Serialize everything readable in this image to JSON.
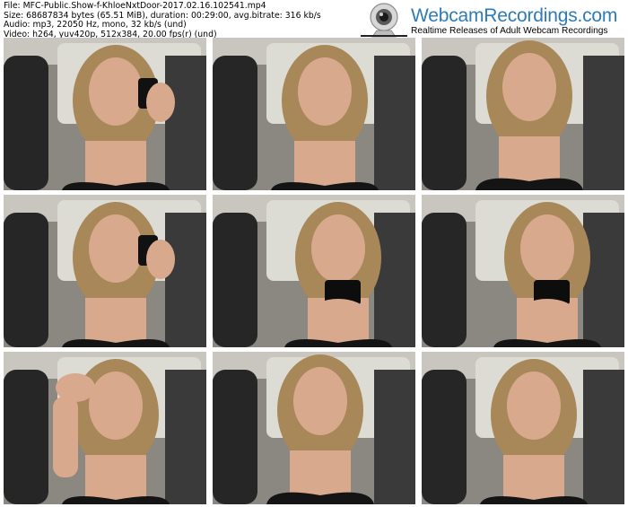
{
  "file_info": {
    "line_file": "File: MFC-Public.Show-f-KhloeNxtDoor-2017.02.16.102541.mp4",
    "line_size": "Size: 68687834 bytes (65.51 MiB), duration: 00:29:00, avg.bitrate: 316 kb/s",
    "line_audio": "Audio: mp3, 22050 Hz, mono, 32 kb/s (und)",
    "line_video": "Video: h264, yuv420p, 512x384, 20.00 fps(r) (und)"
  },
  "logo": {
    "brand": "WebcamRecordings.com",
    "tagline": "Realtime Releases of Adult Webcam Recordings",
    "brand_color": "#2e7bb8"
  },
  "thumbnails": [
    {
      "scene": "phone-call"
    },
    {
      "scene": "car-seat"
    },
    {
      "scene": "close-up"
    },
    {
      "scene": "phone-call"
    },
    {
      "scene": "holding-phone"
    },
    {
      "scene": "holding-phone"
    },
    {
      "scene": "hand-on-head"
    },
    {
      "scene": "close-up"
    },
    {
      "scene": "car-seat"
    }
  ]
}
